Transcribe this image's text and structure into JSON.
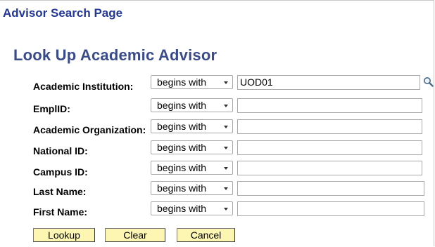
{
  "page_header": "Advisor Search Page",
  "form_title": "Look Up Academic Advisor",
  "fields": [
    {
      "label": "Academic Institution:",
      "operator": "begins with",
      "value": ""
    },
    {
      "label": "EmplID:",
      "operator": "begins with",
      "value": ""
    },
    {
      "label": "Academic Organization:",
      "operator": "begins with",
      "value": ""
    },
    {
      "label": "National ID:",
      "operator": "begins with",
      "value": ""
    },
    {
      "label": "Campus ID:",
      "operator": "begins with",
      "value": ""
    },
    {
      "label": "Last Name:",
      "operator": "begins with",
      "value": ""
    },
    {
      "label": "First Name:",
      "operator": "begins with",
      "value": ""
    }
  ],
  "institution_value": "UOD01",
  "buttons": {
    "lookup": "Lookup",
    "clear": "Clear",
    "cancel": "Cancel"
  },
  "icons": {
    "lookup": "magnifier-icon"
  },
  "colors": {
    "header": "#23389a",
    "title": "#3a4b8c",
    "button_bg": "#fdf6b3"
  }
}
